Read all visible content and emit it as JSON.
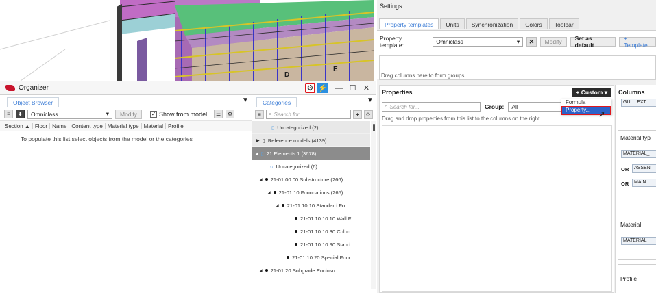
{
  "viewport": {
    "model_labels": [
      "D",
      "E"
    ]
  },
  "organizer": {
    "title": "Organizer",
    "window_buttons": {
      "minimize": "—",
      "maximize": "☐",
      "close": "✕"
    },
    "object_browser": {
      "tab": "Object Browser",
      "template_value": "Omniclass",
      "modify_label": "Modify",
      "show_from_model_label": "Show from model",
      "columns": [
        "Section ▲",
        "Floor",
        "Name",
        "Content type",
        "Material type",
        "Material",
        "Profile"
      ],
      "hint": "To populate this list select objects from the model or the categories"
    },
    "categories": {
      "tab": "Categories",
      "search_placeholder": "Search for...",
      "tree": [
        {
          "label": "Uncategorized (2)"
        },
        {
          "label": "Reference models (4139)"
        },
        {
          "label": "21 Elements 1 (3678)"
        },
        {
          "label": "Uncategorized (6)"
        },
        {
          "label": "21-01 00 00 Substructure (266)"
        },
        {
          "label": "21-01 10 Foundations (265)"
        },
        {
          "label": "21-01 10 10 Standard Fo"
        },
        {
          "label": "21-01 10 10 10 Wall F"
        },
        {
          "label": "21-01 10 10 30 Colun"
        },
        {
          "label": "21-01 10 10 90 Stand"
        },
        {
          "label": "21-01 10 20 Special Four"
        },
        {
          "label": "21-01 20  Subgrade Enclosu"
        }
      ]
    }
  },
  "settings": {
    "title": "Settings",
    "tabs": [
      "Property templates",
      "Units",
      "Synchronization",
      "Colors",
      "Toolbar"
    ],
    "property_template_label": "Property template:",
    "property_template_value": "Omniclass",
    "modify_label": "Modify",
    "set_default_label": "Set as default",
    "template_label": "+ Template",
    "group_area_hint": "Drag columns here to form groups.",
    "properties": {
      "title": "Properties",
      "custom_button": "+ Custom ▾",
      "search_placeholder": "Search for...",
      "group_label": "Group:",
      "group_value": "All",
      "hint": "Drag and drop properties from this list to the columns on the right.",
      "dropdown_items": [
        "Formula",
        "Property..."
      ]
    },
    "columns": {
      "title": "Columns",
      "top_chip": "GUI... EXT...",
      "material_type_label": "Material typ",
      "material_type_chips": [
        "MATERIAL_",
        "ASSEN",
        "MAIN"
      ],
      "or_label": "OR",
      "material_label": "Material",
      "material_chip": "MATERIAL",
      "profile_label": "Profile"
    }
  }
}
